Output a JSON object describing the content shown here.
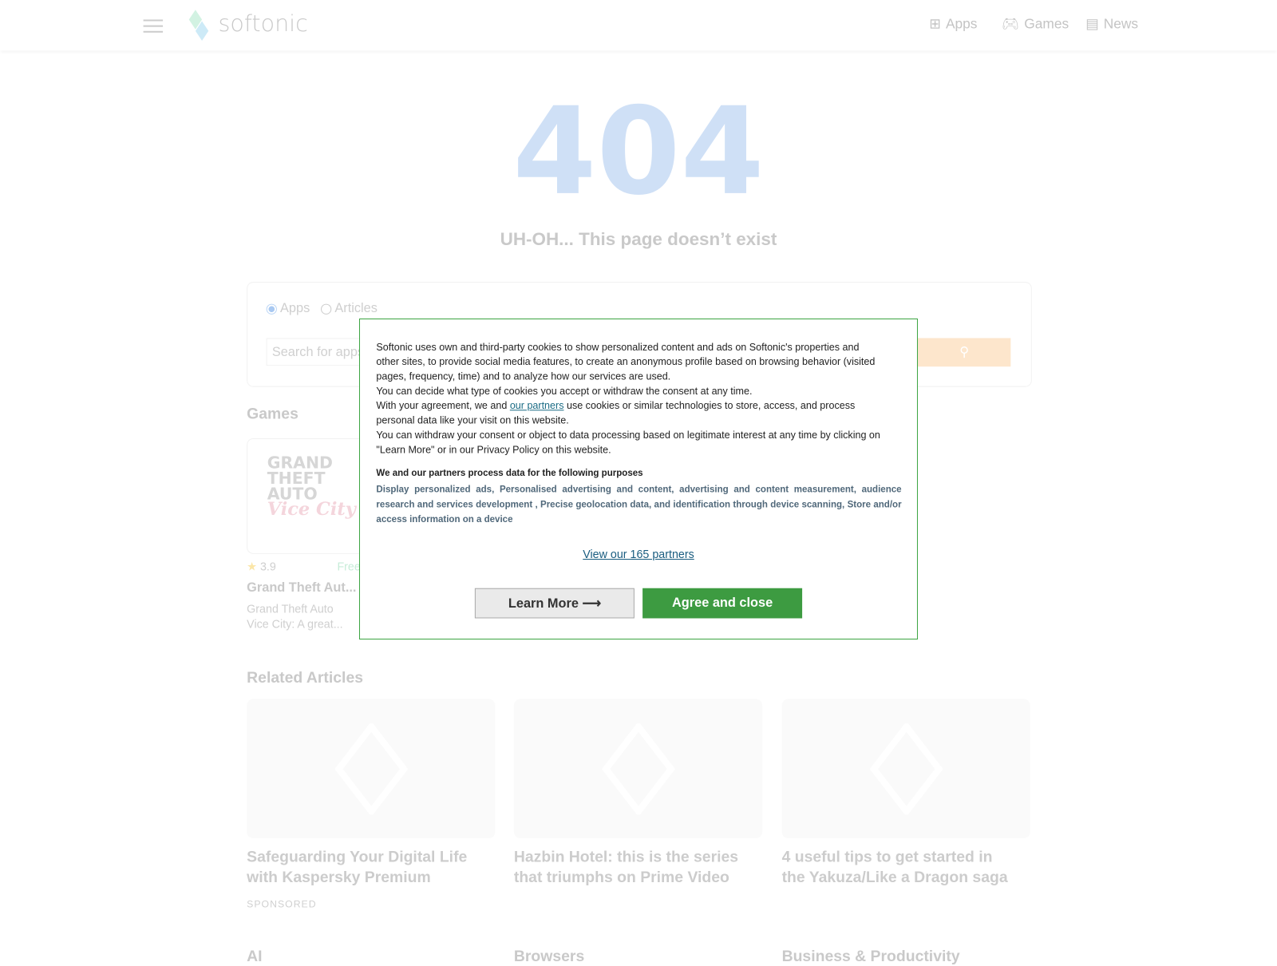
{
  "header": {
    "logo": "softonic",
    "nav": [
      {
        "label": "Apps",
        "icon": "apps-grid-icon"
      },
      {
        "label": "Games",
        "icon": "gamepad-icon"
      },
      {
        "label": "News",
        "icon": "newspaper-icon"
      }
    ]
  },
  "error": {
    "code": "404",
    "message": "UH-OH... This page doesn’t exist"
  },
  "search": {
    "options": [
      "Apps",
      "Articles"
    ],
    "selected": "Apps",
    "placeholder": "Search for apps"
  },
  "games": {
    "heading": "Games",
    "items": [
      {
        "rating": "3.9",
        "price": "Free",
        "title": "Grand Theft Aut...",
        "description_line1": "Grand Theft Auto",
        "description_line2": "Vice City: A great..."
      }
    ]
  },
  "related": {
    "heading": "Related Articles",
    "items": [
      {
        "title": "Safeguarding Your Digital Life with Kaspersky Premium",
        "tag": "SPONSORED"
      },
      {
        "title": "Hazbin Hotel: this is the series that triumphs on Prime Video"
      },
      {
        "title": "4 useful tips to get started in the Yakuza/Like a Dragon saga"
      }
    ]
  },
  "categories": [
    "AI",
    "Browsers",
    "Business & Productivity"
  ],
  "consent": {
    "p1": "Softonic uses own and third-party cookies to show personalized content and ads on Softonic's properties and other sites, to provide social media features, to create an anonymous profile based on browsing behavior (visited pages, frequency, time) and to analyze how our services are used.",
    "p2": "You can decide what type of cookies you accept or withdraw the consent at any time.",
    "p3a": "With your agreement, we and ",
    "p3link": "our partners",
    "p3b": " use cookies or similar technologies to store, access, and process personal data like your visit on this website.",
    "p4": "You can withdraw your consent or object to data processing based on legitimate interest at any time by clicking on \"Learn More\" or in our Privacy Policy on this website.",
    "purposes_heading": "We and our partners process data for the following purposes",
    "purposes": "Display personalized ads, Personalised advertising and content, advertising and content measurement, audience research and services development , Precise geolocation data, and identification through device scanning, Store and/or access information on a device",
    "partners_link": "View our 165 partners",
    "learn_more": "Learn More ⟶",
    "agree": "Agree and close"
  },
  "colors": {
    "accent_green": "#3d9b41",
    "link": "#1a6b84",
    "error_code": "#cfe0f6"
  }
}
